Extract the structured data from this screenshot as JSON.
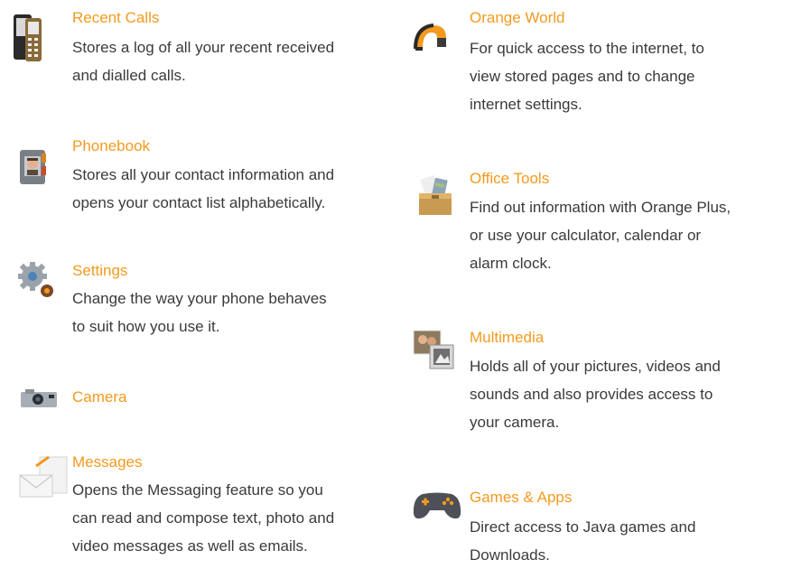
{
  "accent_color": "#f39a1e",
  "text_color": "#3a3a3a",
  "left_column": [
    {
      "id": "recent-calls",
      "icon": "mobile-phone-icon",
      "title": "Recent Calls",
      "description": [
        "Stores a log of all your recent received",
        "and dialled calls."
      ]
    },
    {
      "id": "phonebook",
      "icon": "address-book-icon",
      "title": "Phonebook",
      "description": [
        "Stores all your contact information and",
        "opens your contact list alphabetically."
      ]
    },
    {
      "id": "settings",
      "icon": "gear-icon",
      "title": "Settings",
      "description": [
        "Change the way your phone behaves",
        "to suit how you use it."
      ]
    },
    {
      "id": "camera",
      "icon": "camera-icon",
      "title": "Camera",
      "description": []
    },
    {
      "id": "messages",
      "icon": "envelope-icon",
      "title": "Messages",
      "description": [
        "Opens the Messaging feature so you",
        "can read and compose text, photo and",
        "video messages as well as emails."
      ]
    }
  ],
  "right_column": [
    {
      "id": "orange-world",
      "icon": "orange-world-icon",
      "title": "Orange World",
      "description": [
        "For quick access to the internet, to",
        "view stored pages and to change",
        "internet settings."
      ]
    },
    {
      "id": "office-tools",
      "icon": "toolbox-icon",
      "title": "Office Tools",
      "description": [
        "Find out information with Orange Plus,",
        "or use your calculator, calendar or",
        "alarm clock."
      ]
    },
    {
      "id": "multimedia",
      "icon": "photos-icon",
      "title": "Multimedia",
      "description": [
        "Holds all of your pictures, videos and",
        "sounds and also provides access to",
        "your camera."
      ]
    },
    {
      "id": "games-apps",
      "icon": "gamepad-icon",
      "title": "Games & Apps",
      "description": [
        "Direct access to Java games and",
        "Downloads."
      ]
    }
  ]
}
